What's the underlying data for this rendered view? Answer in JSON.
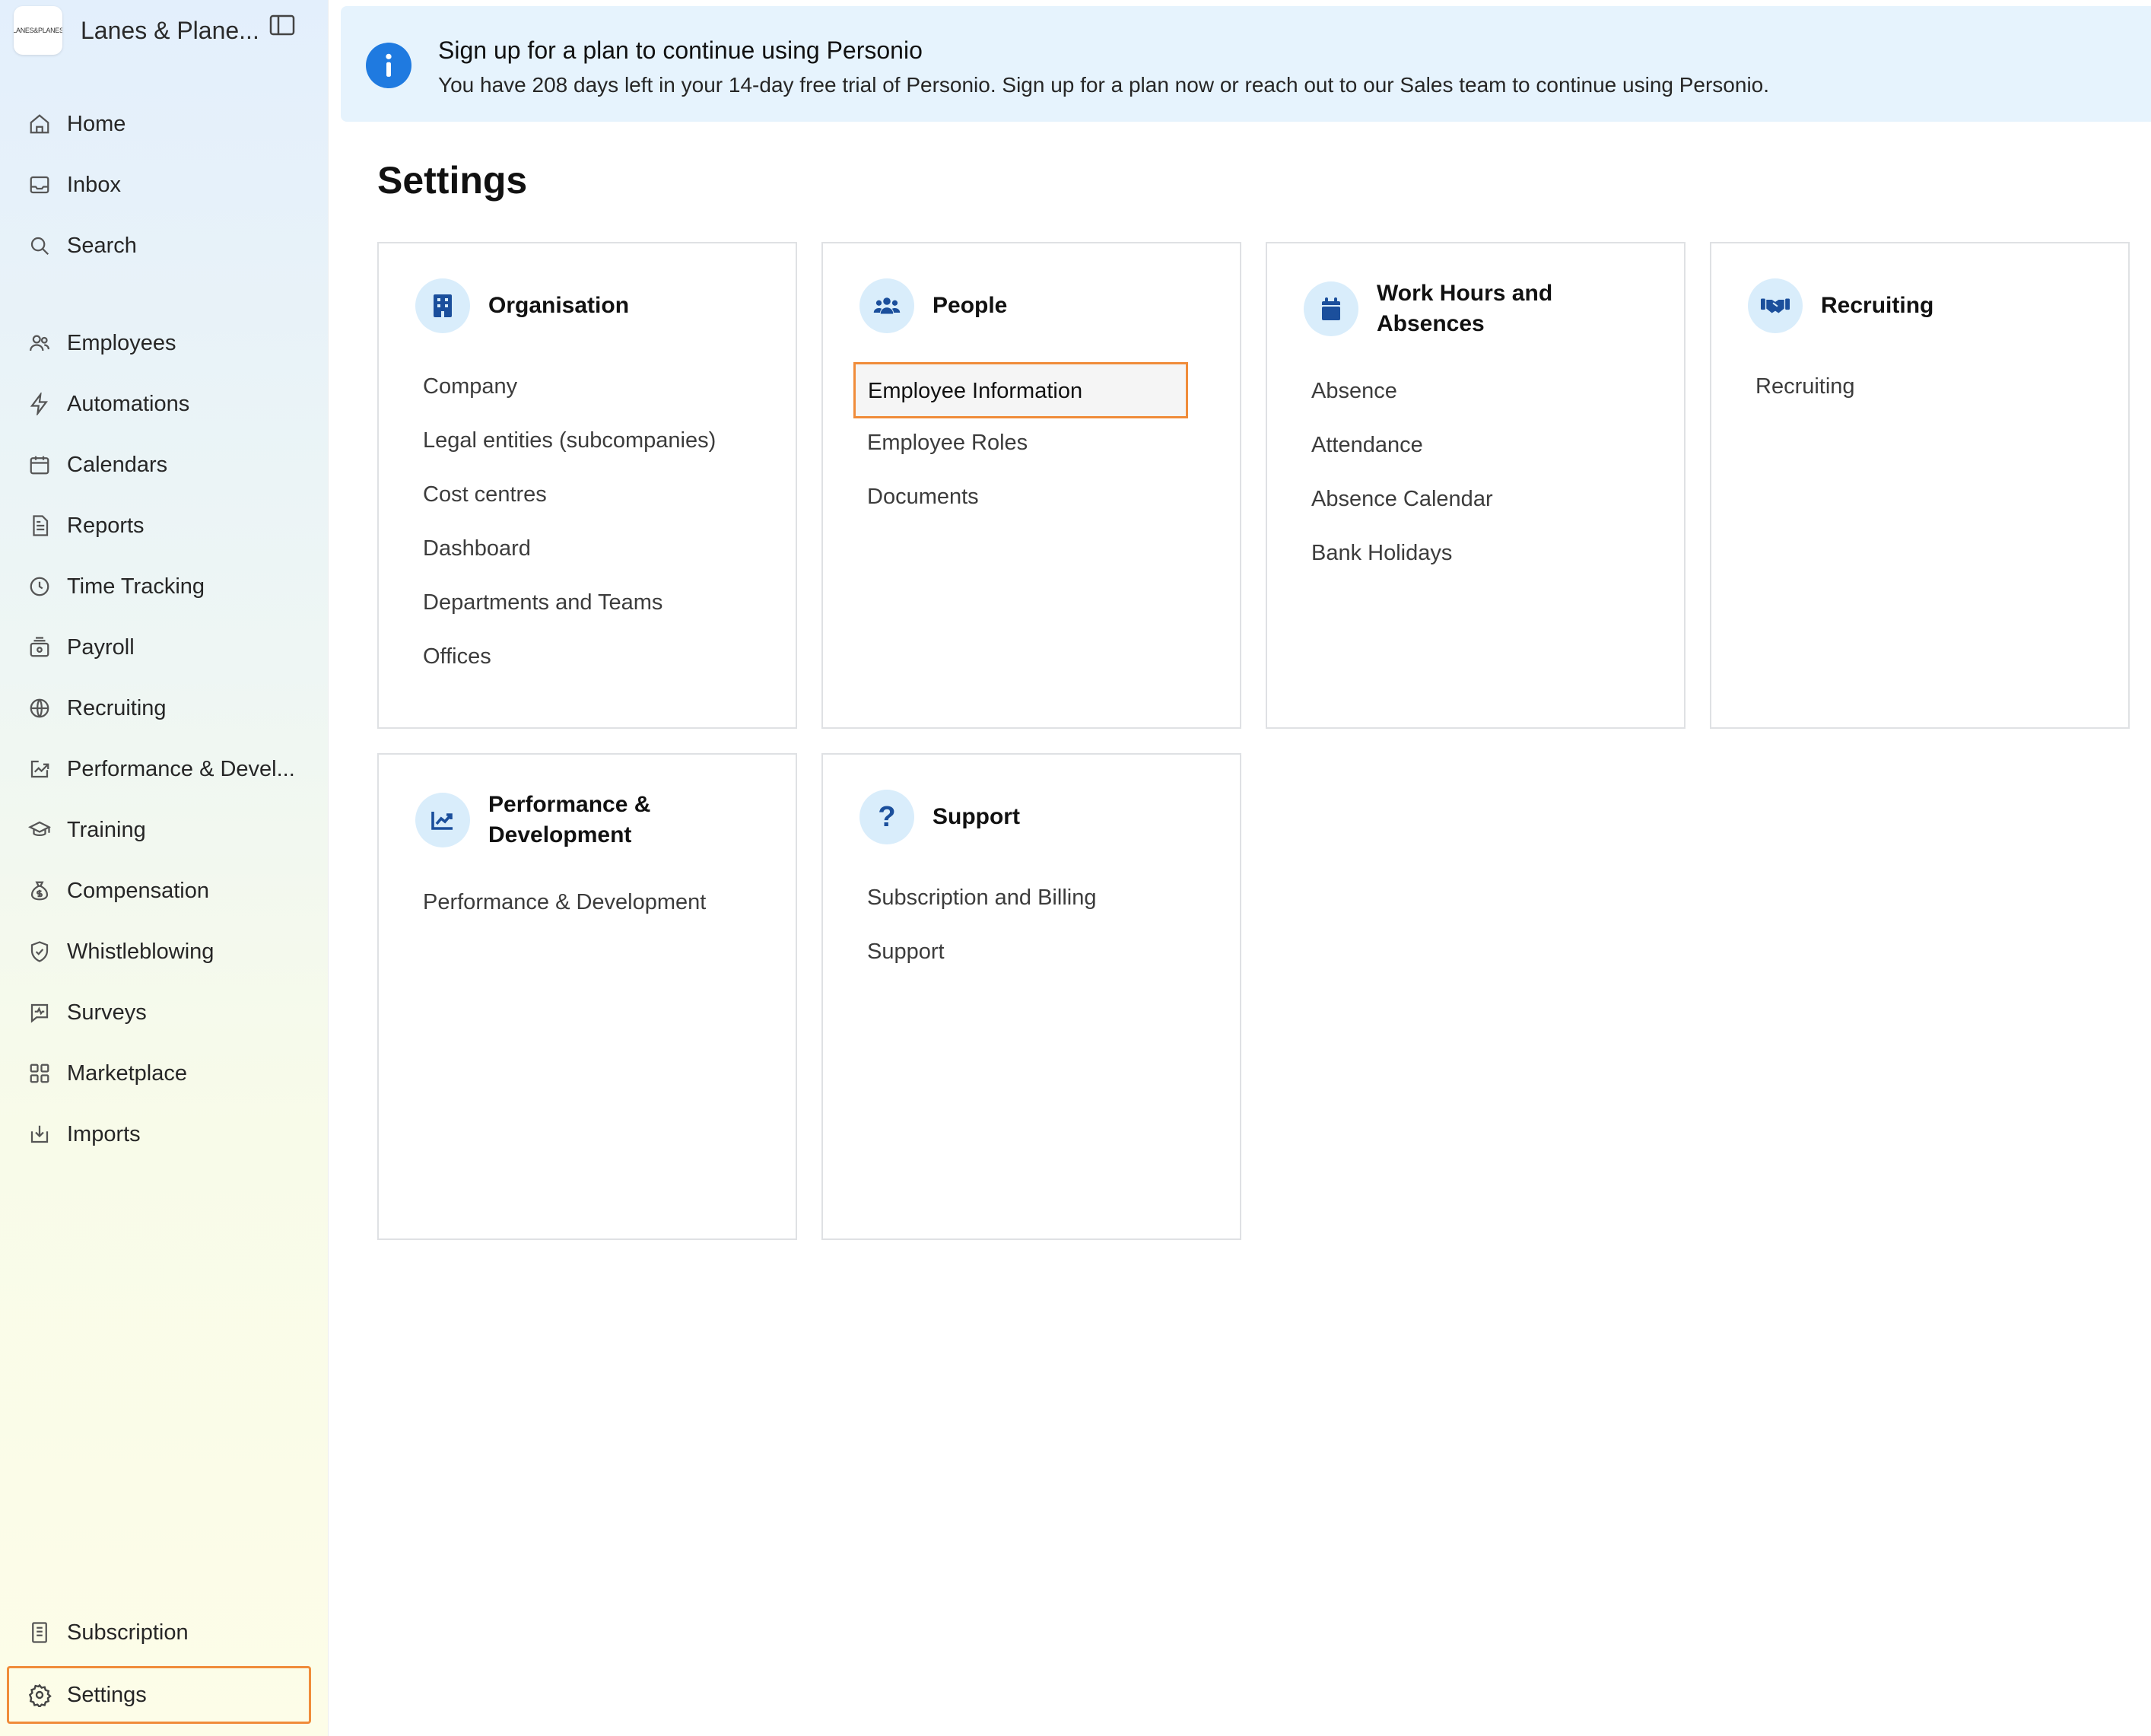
{
  "brand": {
    "name": "Lanes & Plane...",
    "logo_text": "LANES&PLANES"
  },
  "sidebar": {
    "items": [
      {
        "label": "Home",
        "icon": "home-icon"
      },
      {
        "label": "Inbox",
        "icon": "inbox-icon"
      },
      {
        "label": "Search",
        "icon": "search-icon"
      },
      {
        "label": "Employees",
        "icon": "people-icon"
      },
      {
        "label": "Automations",
        "icon": "bolt-icon"
      },
      {
        "label": "Calendars",
        "icon": "calendar-icon"
      },
      {
        "label": "Reports",
        "icon": "report-icon"
      },
      {
        "label": "Time Tracking",
        "icon": "clock-icon"
      },
      {
        "label": "Payroll",
        "icon": "payroll-icon"
      },
      {
        "label": "Recruiting",
        "icon": "globe-icon"
      },
      {
        "label": "Performance & Devel...",
        "icon": "chart-icon"
      },
      {
        "label": "Training",
        "icon": "graduation-cap-icon"
      },
      {
        "label": "Compensation",
        "icon": "money-bag-icon"
      },
      {
        "label": "Whistleblowing",
        "icon": "shield-icon"
      },
      {
        "label": "Surveys",
        "icon": "survey-icon"
      },
      {
        "label": "Marketplace",
        "icon": "grid-icon"
      },
      {
        "label": "Imports",
        "icon": "import-icon"
      }
    ],
    "bottom_items": [
      {
        "label": "Subscription",
        "icon": "receipt-icon"
      },
      {
        "label": "Settings",
        "icon": "gear-icon",
        "active": true
      }
    ]
  },
  "banner": {
    "title": "Sign up for a plan to continue using Personio",
    "text": "You have 208 days left in your 14-day free trial of Personio. Sign up for a plan now or reach out to our Sales team to continue using Personio."
  },
  "page": {
    "title": "Settings"
  },
  "cards": [
    {
      "title": "Organisation",
      "icon": "building-icon",
      "links": [
        "Company",
        "Legal entities (subcompanies)",
        "Cost centres",
        "Dashboard",
        "Departments and Teams",
        "Offices"
      ]
    },
    {
      "title": "People",
      "icon": "people-group-icon",
      "links": [
        "Employee Information",
        "Employee Roles",
        "Documents"
      ]
    },
    {
      "title": "Work Hours and Absences",
      "icon": "calendar-icon",
      "links": [
        "Absence",
        "Attendance",
        "Absence Calendar",
        "Bank Holidays"
      ]
    },
    {
      "title": "Recruiting",
      "icon": "handshake-icon",
      "links": [
        "Recruiting"
      ]
    },
    {
      "title": "Performance & Development",
      "icon": "chart-line-icon",
      "links": [
        "Performance & Development"
      ]
    },
    {
      "title": "Support",
      "icon": "question-icon",
      "links": [
        "Subscription and Billing",
        "Support"
      ]
    }
  ],
  "colors": {
    "accent": "#1f7ae0",
    "highlight": "#f08c3a",
    "banner_bg": "#e6f3fd",
    "icon_bg": "#d9edfb",
    "icon_fg": "#1b4f9c"
  }
}
